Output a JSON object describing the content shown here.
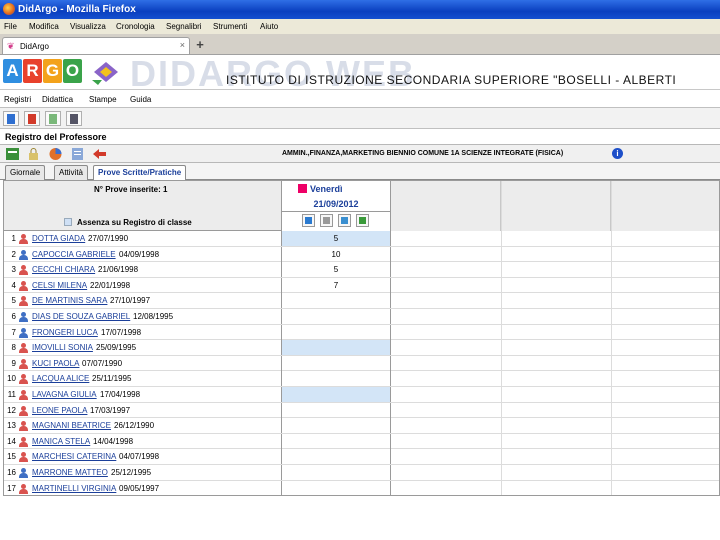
{
  "window": {
    "title": "DidArgo - Mozilla Firefox"
  },
  "menubar": [
    "File",
    "Modifica",
    "Visualizza",
    "Cronologia",
    "Segnalibri",
    "Strumenti",
    "Aiuto"
  ],
  "tab": {
    "label": "DidArgo",
    "close": "×",
    "new_tab": "+"
  },
  "banner": {
    "logo_letters": [
      "A",
      "R",
      "G",
      "O"
    ],
    "logo_colors": [
      "#2f8ee0",
      "#e8412c",
      "#f3a21b",
      "#3aa34a"
    ],
    "watermark": "DIDARGO WEB",
    "school": "ISTITUTO DI ISTRUZIONE SECONDARIA SUPERIORE \"BOSELLI - ALBERTI"
  },
  "appmenu": [
    "Registri",
    "Didattica",
    "Stampe",
    "Guida"
  ],
  "section_title": "Registro del Professore",
  "class_info": "AMMIN.,FINANZA,MARKETING BIENNIO COMUNE   1A   SCIENZE INTEGRATE (FISICA)",
  "info_icon_label": "i",
  "subtabs": [
    "Giornale",
    "Attività",
    "Prove Scritte/Pratiche"
  ],
  "grid": {
    "prove_count": "N° Prove inserite: 1",
    "absence_label": "Assenza su Registro di classe",
    "day": "Venerdì",
    "date": "21/09/2012",
    "students": [
      {
        "n": "1",
        "name": "DOTTA GIADA",
        "birth": "27/07/1990",
        "vote": "5",
        "g": "f",
        "shaded": true
      },
      {
        "n": "2",
        "name": "CAPOCCIA GABRIELE",
        "birth": "04/09/1998",
        "vote": "10",
        "g": "m",
        "shaded": false
      },
      {
        "n": "3",
        "name": "CECCHI CHIARA",
        "birth": "21/06/1998",
        "vote": "5",
        "g": "f",
        "shaded": false
      },
      {
        "n": "4",
        "name": "CELSI MILENA",
        "birth": "22/01/1998",
        "vote": "7",
        "g": "f",
        "shaded": false
      },
      {
        "n": "5",
        "name": "DE MARTINIS SARA",
        "birth": "27/10/1997",
        "vote": "",
        "g": "f",
        "shaded": false
      },
      {
        "n": "6",
        "name": "DIAS DE SOUZA GABRIEL",
        "birth": "12/08/1995",
        "vote": "",
        "g": "m",
        "shaded": false
      },
      {
        "n": "7",
        "name": "FRONGERI LUCA",
        "birth": "17/07/1998",
        "vote": "",
        "g": "m",
        "shaded": false
      },
      {
        "n": "8",
        "name": "IMOVILLI SONIA",
        "birth": "25/09/1995",
        "vote": "",
        "g": "f",
        "shaded": true
      },
      {
        "n": "9",
        "name": "KUCI PAOLA",
        "birth": "07/07/1990",
        "vote": "",
        "g": "f",
        "shaded": false
      },
      {
        "n": "10",
        "name": "LACQUA ALICE",
        "birth": "25/11/1995",
        "vote": "",
        "g": "f",
        "shaded": false
      },
      {
        "n": "11",
        "name": "LAVAGNA GIULIA",
        "birth": "17/04/1998",
        "vote": "",
        "g": "f",
        "shaded": true
      },
      {
        "n": "12",
        "name": "LEONE PAOLA",
        "birth": "17/03/1997",
        "vote": "",
        "g": "f",
        "shaded": false
      },
      {
        "n": "13",
        "name": "MAGNANI BEATRICE",
        "birth": "26/12/1990",
        "vote": "",
        "g": "f",
        "shaded": false
      },
      {
        "n": "14",
        "name": "MANICA STELA",
        "birth": "14/04/1998",
        "vote": "",
        "g": "f",
        "shaded": false
      },
      {
        "n": "15",
        "name": "MARCHESI CATERINA",
        "birth": "04/07/1998",
        "vote": "",
        "g": "f",
        "shaded": false
      },
      {
        "n": "16",
        "name": "MARRONE MATTEO",
        "birth": "25/12/1995",
        "vote": "",
        "g": "m",
        "shaded": false
      },
      {
        "n": "17",
        "name": "MARTINELLI VIRGINIA",
        "birth": "09/05/1997",
        "vote": "",
        "g": "r",
        "shaded": false
      }
    ]
  },
  "colors": {
    "link": "#1b3f9a",
    "shaded": "#d3e5f7",
    "female": "#d9534f",
    "male": "#3f6fc4"
  }
}
